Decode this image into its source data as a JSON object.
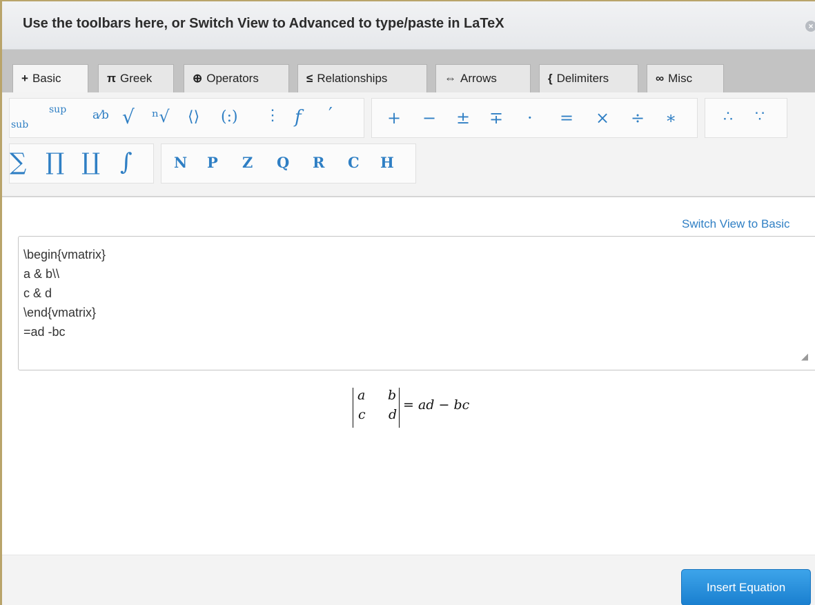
{
  "dialog": {
    "title": "Use the toolbars here, or Switch View to Advanced to type/paste in LaTeX",
    "close_icon": "close-icon",
    "close_glyph": "×"
  },
  "tabs": [
    {
      "glyph": "+",
      "label": "Basic",
      "active": true
    },
    {
      "glyph": "π",
      "label": "Greek"
    },
    {
      "glyph": "⊕",
      "label": "Operators"
    },
    {
      "glyph": "≤",
      "label": "Relationships"
    },
    {
      "glyph": "⇔",
      "label": "Arrows"
    },
    {
      "glyph": "{",
      "label": "Delimiters"
    },
    {
      "glyph": "∞",
      "label": "Misc"
    }
  ],
  "toolbar": {
    "structure": {
      "sub": "sub",
      "sup": "sup",
      "frac": "a⁄b",
      "sqrt": "√",
      "nthroot": "ⁿ√",
      "angle": "⟨⟩",
      "binom": "(:)",
      "vline": "⋮",
      "func": "f",
      "prime": "′"
    },
    "operators": [
      "+",
      "−",
      "±",
      "∓",
      "·",
      "=",
      "×",
      "÷",
      "∗"
    ],
    "logic": [
      "∴",
      "∵"
    ],
    "bigops": [
      "∑",
      "∏",
      "∐",
      "∫"
    ],
    "sets": [
      "N",
      "P",
      "Z",
      "Q",
      "R",
      "C",
      "H"
    ]
  },
  "switch_link": "Switch View to Basic",
  "editor": {
    "lines": [
      "\\begin{vmatrix}",
      "a & b\\\\",
      "c & d",
      "\\end{vmatrix}",
      "=ad -bc"
    ]
  },
  "preview": {
    "a": "a",
    "b": "b",
    "c": "c",
    "d": "d",
    "rhs": "= ad − bc"
  },
  "footer": {
    "insert_label": "Insert Equation"
  },
  "colors": {
    "accent": "#2f7fc4",
    "button": "#1a7fcf",
    "border_gold": "#b9a46a"
  }
}
